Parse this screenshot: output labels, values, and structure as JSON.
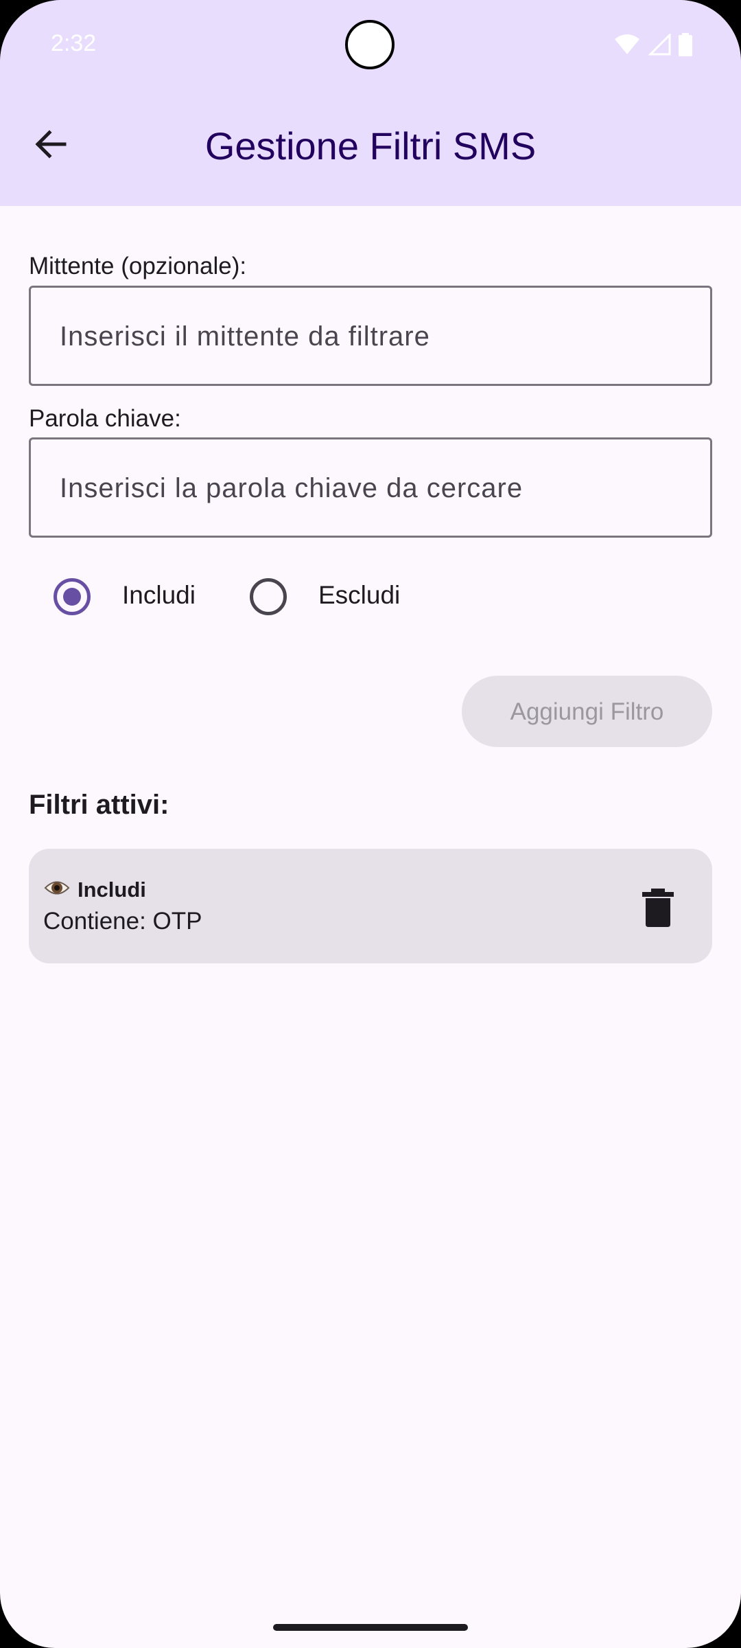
{
  "status_bar": {
    "time": "2:32"
  },
  "app_bar": {
    "title": "Gestione Filtri SMS"
  },
  "form": {
    "sender_label": "Mittente (opzionale):",
    "sender_placeholder": "Inserisci il mittente da filtrare",
    "keyword_label": "Parola chiave:",
    "keyword_placeholder": "Inserisci la parola chiave da cercare",
    "options": [
      {
        "label": "Includi",
        "selected": true
      },
      {
        "label": "Escludi",
        "selected": false
      }
    ],
    "add_button_label": "Aggiungi Filtro"
  },
  "active_filters": {
    "heading": "Filtri attivi:",
    "items": [
      {
        "mode": "Includi",
        "description": "Contiene: OTP"
      }
    ]
  },
  "colors": {
    "app_bar_bg": "#e9ddfe",
    "accent": "#6750a4",
    "title": "#21005e",
    "surface": "#fdf7fe"
  },
  "icons": {
    "back": "arrow-back-icon",
    "eye": "eye-icon",
    "delete": "trash-icon"
  }
}
